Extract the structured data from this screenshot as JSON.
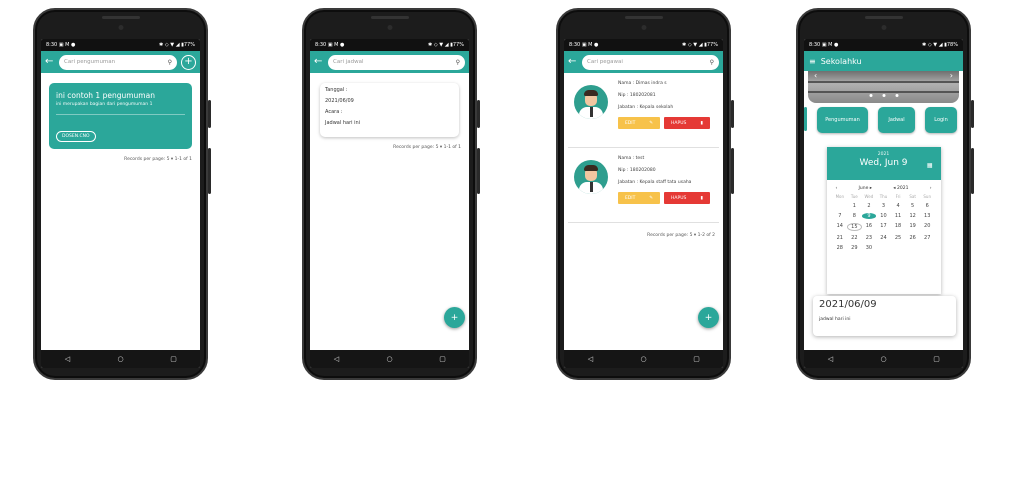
{
  "status": {
    "time": "8:30",
    "icons": "▣ M ●",
    "right": "✱ ◇ ▼ ◢ ▮77%",
    "right4": "✱ ◇ ▼ ◢ ▮78%"
  },
  "nav": {
    "back": "◁",
    "home": "○",
    "recent": "▢"
  },
  "phone1": {
    "search_placeholder": "Cari pengumuman",
    "card": {
      "title": "ini contoh 1 pengumuman",
      "subtitle": "ini merupakan bagian dari pengumuman 1",
      "button": "DOSEN.CNO"
    },
    "pager": {
      "label": "Records per page:",
      "value": "5",
      "range": "1-1 of 1"
    }
  },
  "phone2": {
    "search_placeholder": "Cari jadwal",
    "card": {
      "tanggal_label": "Tanggal :",
      "tanggal_value": "2021/06/09",
      "acara_label": "Acara :",
      "acara_value": "Jadwal hari ini"
    },
    "pager": {
      "label": "Records per page:",
      "value": "5",
      "range": "1-1 of 1"
    }
  },
  "phone3": {
    "search_placeholder": "Cari pegawai",
    "employees": [
      {
        "nama": "Nama : Dimas indra s",
        "nip": "Nip : 180202081",
        "jabatan": "Jabatan : Kepala sekolah",
        "edit": "EDIT",
        "hapus": "HAPUS"
      },
      {
        "nama": "Nama : test",
        "nip": "Nip : 180202080",
        "jabatan": "Jabatan : Kepala staff tata usaha",
        "edit": "EDIT",
        "hapus": "HAPUS"
      }
    ],
    "pager": {
      "label": "Records per page:",
      "value": "5",
      "range": "1-2 of 2"
    }
  },
  "phone4": {
    "app_title": "Sekolahku",
    "buttons": [
      "Pengumuman",
      "Jadwal",
      "Login"
    ],
    "calendar": {
      "year": "2021",
      "date": "Wed, Jun 9",
      "month": "June",
      "year_nav": "2021",
      "dow": [
        "Mon",
        "Tue",
        "Wed",
        "Thu",
        "Fri",
        "Sat",
        "Sun"
      ],
      "days": [
        "",
        "1",
        "2",
        "3",
        "4",
        "5",
        "6",
        "7",
        "8",
        "9",
        "10",
        "11",
        "12",
        "13",
        "14",
        "15",
        "16",
        "17",
        "18",
        "19",
        "20",
        "21",
        "22",
        "23",
        "24",
        "25",
        "26",
        "27",
        "28",
        "29",
        "30",
        "",
        "",
        "",
        "",
        ""
      ],
      "selected_day": "9",
      "today_day": "15"
    },
    "date_card": {
      "date": "2021/06/09",
      "note": "jadwal hari ini"
    }
  }
}
